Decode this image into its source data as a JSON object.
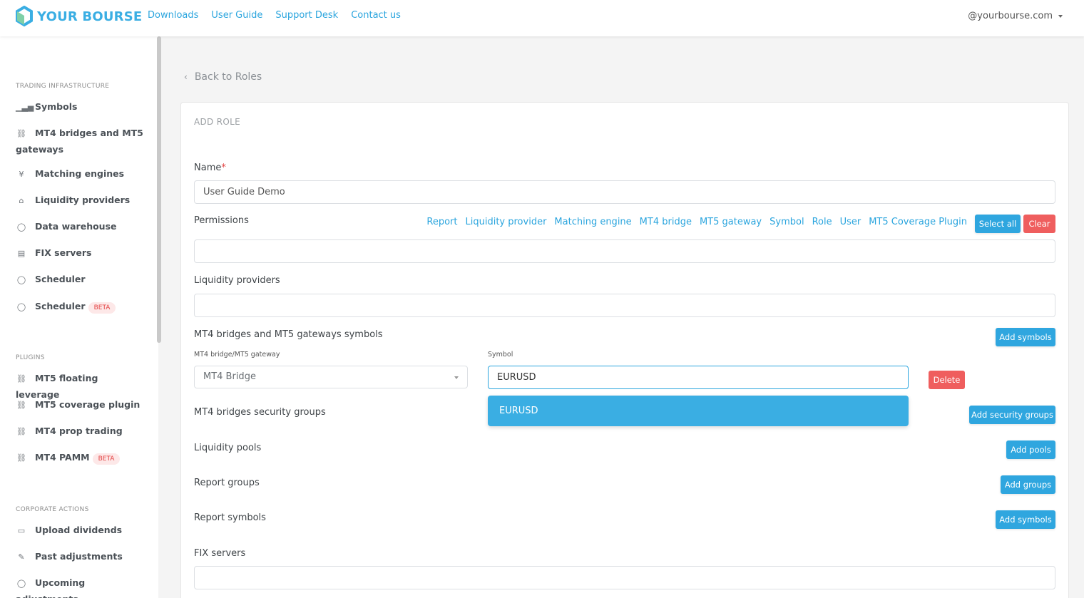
{
  "header": {
    "logo_text": "YOUR BOURSE",
    "nav": [
      "Downloads",
      "User Guide",
      "Support Desk",
      "Contact us"
    ],
    "user": "@yourbourse.com"
  },
  "sidebar": {
    "sections": [
      {
        "title": "TRADING INFRASTRUCTURE",
        "items": [
          {
            "label": "Symbols",
            "icon": "bar-chart-icon"
          },
          {
            "label": "MT4 bridges and MT5 gateways",
            "icon": "link-icon"
          },
          {
            "label": "Matching engines",
            "icon": "yen-icon"
          },
          {
            "label": "Liquidity providers",
            "icon": "bank-icon"
          },
          {
            "label": "Data warehouse",
            "icon": "circle-icon"
          },
          {
            "label": "FIX servers",
            "icon": "document-icon"
          },
          {
            "label": "Scheduler",
            "icon": "circle-icon"
          },
          {
            "label": "Scheduler",
            "icon": "circle-icon",
            "badge": "BETA"
          }
        ]
      },
      {
        "title": "PLUGINS",
        "items": [
          {
            "label": "MT5 floating leverage",
            "icon": "link-icon"
          },
          {
            "label": "MT5 coverage plugin",
            "icon": "link-icon"
          },
          {
            "label": "MT4 prop trading",
            "icon": "link-icon"
          },
          {
            "label": "MT4 PAMM",
            "icon": "link-icon",
            "badge": "BETA"
          }
        ]
      },
      {
        "title": "CORPORATE ACTIONS",
        "items": [
          {
            "label": "Upload dividends",
            "icon": "folder-icon"
          },
          {
            "label": "Past adjustments",
            "icon": "edit-icon"
          },
          {
            "label": "Upcoming adjustments",
            "icon": "circle-icon"
          }
        ]
      }
    ]
  },
  "main": {
    "back_link": "Back to Roles",
    "card_title": "ADD ROLE",
    "name_label": "Name",
    "name_required": "*",
    "name_value": "User Guide Demo",
    "permissions_label": "Permissions",
    "permission_links": [
      "Report",
      "Liquidity provider",
      "Matching engine",
      "MT4 bridge",
      "MT5 gateway",
      "Symbol",
      "Role",
      "User",
      "MT5 Coverage Plugin"
    ],
    "select_all": "Select all",
    "clear": "Clear",
    "liquidity_providers_label": "Liquidity providers",
    "mt_symbols_label": "MT4 bridges and MT5 gateways symbols",
    "add_symbols": "Add symbols",
    "bridge_col_label": "MT4 bridge/MT5 gateway",
    "symbol_col_label": "Symbol",
    "bridge_value": "MT4 Bridge",
    "symbol_value": "EURUSD",
    "dropdown_option": "EURUSD",
    "delete": "Delete",
    "security_groups_label": "MT4 bridges security groups",
    "add_security_groups": "Add security groups",
    "liquidity_pools_label": "Liquidity pools",
    "add_pools": "Add pools",
    "report_groups_label": "Report groups",
    "add_groups": "Add groups",
    "report_symbols_label": "Report symbols",
    "add_report_symbols": "Add symbols",
    "fix_servers_label": "FIX servers"
  },
  "colors": {
    "accent": "#2ba5de",
    "danger": "#ef5e5e",
    "beta_text": "#e34343"
  }
}
